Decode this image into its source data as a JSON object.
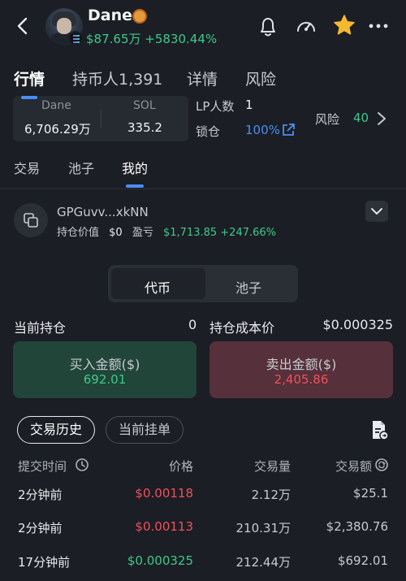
{
  "header": {
    "name": "Dane",
    "market_cap": "$87.65万",
    "change": "+5830.44%"
  },
  "icons": {
    "back": "chevron-left-icon",
    "bell": "bell-icon",
    "speed": "gauge-icon",
    "star": "star-icon",
    "more": "more-icon",
    "copy": "copy-icon",
    "external": "external-link-icon",
    "clock": "clock-icon",
    "refresh": "refresh-icon",
    "export": "export-icon"
  },
  "colors": {
    "accent": "#4a8ef5",
    "up": "#3ec98c",
    "down": "#f0505d",
    "star": "#f5b82e",
    "background": "#1b1e24"
  },
  "main_tabs": [
    {
      "label": "行情",
      "active": true
    },
    {
      "label": "持币人1,391",
      "active": false
    },
    {
      "label": "详情",
      "active": false
    },
    {
      "label": "风险",
      "active": false
    }
  ],
  "pool": {
    "dane_label": "Dane",
    "dane_value": "6,706.29万",
    "sol_label": "SOL",
    "sol_value": "335.2"
  },
  "stats": {
    "lp_label": "LP人数",
    "lp_value": "1",
    "lock_label": "锁仓",
    "lock_value": "100%",
    "risk_label": "风险",
    "risk_value": "40"
  },
  "sub_tabs": [
    {
      "label": "交易",
      "active": false
    },
    {
      "label": "池子",
      "active": false
    },
    {
      "label": "我的",
      "active": true
    }
  ],
  "wallet": {
    "address": "GPGuvv...xkNN",
    "holding_label": "持仓价值",
    "holding_value": "$0",
    "pnl_label": "盈亏",
    "pnl_value": "$1,713.85 +247.66%"
  },
  "segmented": {
    "token": "代币",
    "pool": "池子"
  },
  "position": {
    "current_label": "当前持仓",
    "current_value": "0",
    "cost_label": "持仓成本价",
    "cost_value": "$0.000325",
    "buy_label": "买入金额($)",
    "buy_value": "692.01",
    "sell_label": "卖出金额($)",
    "sell_value": "2,405.86"
  },
  "history_tabs": {
    "history": "交易历史",
    "orders": "当前挂单"
  },
  "table": {
    "headers": {
      "time": "提交时间",
      "price": "价格",
      "amount": "交易量",
      "value": "交易额"
    },
    "rows": [
      {
        "time": "2分钟前",
        "price": "$0.00118",
        "amount": "2.12万",
        "value": "$25.1",
        "side": "sell"
      },
      {
        "time": "2分钟前",
        "price": "$0.00113",
        "amount": "210.31万",
        "value": "$2,380.76",
        "side": "sell"
      },
      {
        "time": "17分钟前",
        "price": "$0.000325",
        "amount": "212.44万",
        "value": "$692.01",
        "side": "buy"
      }
    ]
  }
}
